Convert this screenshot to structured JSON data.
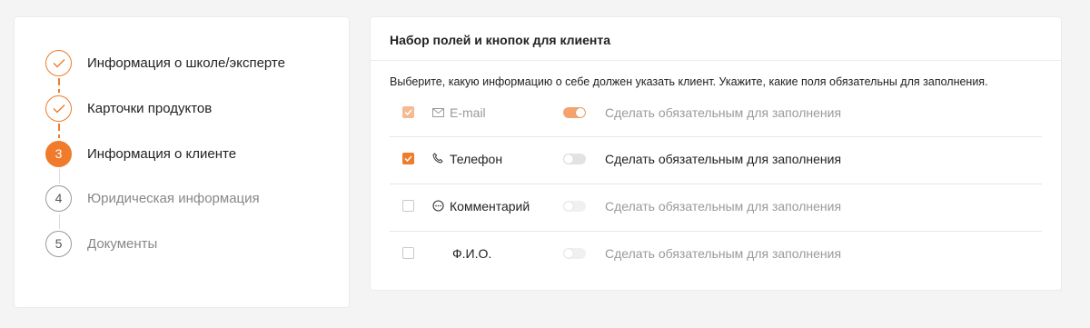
{
  "steps": [
    {
      "number": "1",
      "label": "Информация о школе/эксперте",
      "state": "done"
    },
    {
      "number": "2",
      "label": "Карточки продуктов",
      "state": "done"
    },
    {
      "number": "3",
      "label": "Информация о клиенте",
      "state": "active"
    },
    {
      "number": "4",
      "label": "Юридическая информация",
      "state": "pending"
    },
    {
      "number": "5",
      "label": "Документы",
      "state": "pending"
    }
  ],
  "fields_panel": {
    "title": "Набор полей и кнопок для клиента",
    "description": "Выберите, какую информацию о себе должен указать клиент. Укажите, какие поля обязательны для заполнения.",
    "fields": [
      {
        "label": "E-mail",
        "icon": "envelope-icon",
        "checked": true,
        "checkbox_disabled": true,
        "required": true,
        "required_label": "Сделать обязательным для заполнения"
      },
      {
        "label": "Телефон",
        "icon": "phone-icon",
        "checked": true,
        "checkbox_disabled": false,
        "required": false,
        "required_label": "Сделать обязательным для заполнения"
      },
      {
        "label": "Комментарий",
        "icon": "chat-bubble-icon",
        "checked": false,
        "checkbox_disabled": false,
        "required": false,
        "required_label": "Сделать обязательным для заполнения"
      },
      {
        "label": "Ф.И.О.",
        "icon": "",
        "checked": false,
        "checkbox_disabled": false,
        "required": false,
        "required_label": "Сделать обязательным для заполнения"
      }
    ]
  },
  "colors": {
    "accent": "#f07b2b",
    "accent_light": "#f5a36e",
    "background": "#f4f4f4"
  }
}
